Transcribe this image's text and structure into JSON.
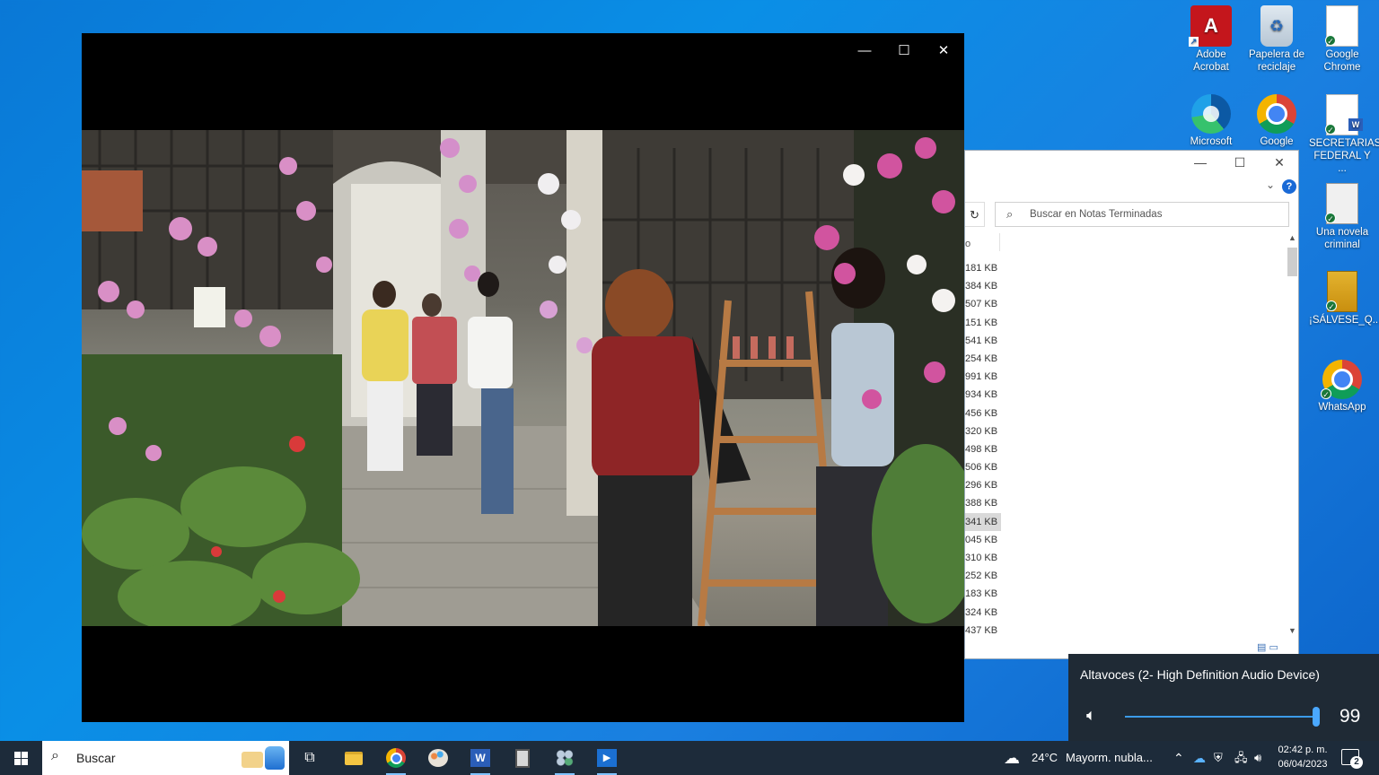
{
  "desktop": {
    "icons": [
      {
        "label": "Adobe Acrobat",
        "icon": "pdf-icon"
      },
      {
        "label": "Papelera de reciclaje",
        "icon": "recycle-bin-icon"
      },
      {
        "label": "Google Chrome",
        "icon": "document-shortcut-icon"
      },
      {
        "label": "Microsoft",
        "icon": "edge-icon"
      },
      {
        "label": "Google",
        "icon": "chrome-icon"
      },
      {
        "label": "SECRETARIAS FEDERAL Y ...",
        "icon": "word-document-icon"
      },
      {
        "label": "Una novela criminal",
        "icon": "pdf-book-icon"
      },
      {
        "label": "¡SÁLVESE_Q...",
        "icon": "pdf-book-icon"
      },
      {
        "label": "WhatsApp",
        "icon": "chrome-icon"
      }
    ]
  },
  "explorer": {
    "search_placeholder": "Buscar en Notas Terminadas",
    "column_fragment": "o",
    "sizes": [
      "181 KB",
      "384 KB",
      "507 KB",
      "151 KB",
      "541 KB",
      "254 KB",
      "991 KB",
      "934 KB",
      "456 KB",
      "320 KB",
      "498 KB",
      "506 KB",
      "296 KB",
      "388 KB",
      "341 KB",
      "045 KB",
      "310 KB",
      "252 KB",
      "183 KB",
      "324 KB",
      "437 KB"
    ],
    "selected_index": 14
  },
  "player": {
    "minimize": "—",
    "maximize": "☐",
    "close": "✕"
  },
  "volume": {
    "device": "Altavoces (2- High Definition Audio Device)",
    "value": "99",
    "level_percent": 99
  },
  "taskbar": {
    "search_label": "Buscar",
    "weather_temp": "24°C",
    "weather_desc": "Mayorm. nubla...",
    "time": "02:42 p. m.",
    "date": "06/04/2023",
    "notifications": "2"
  }
}
